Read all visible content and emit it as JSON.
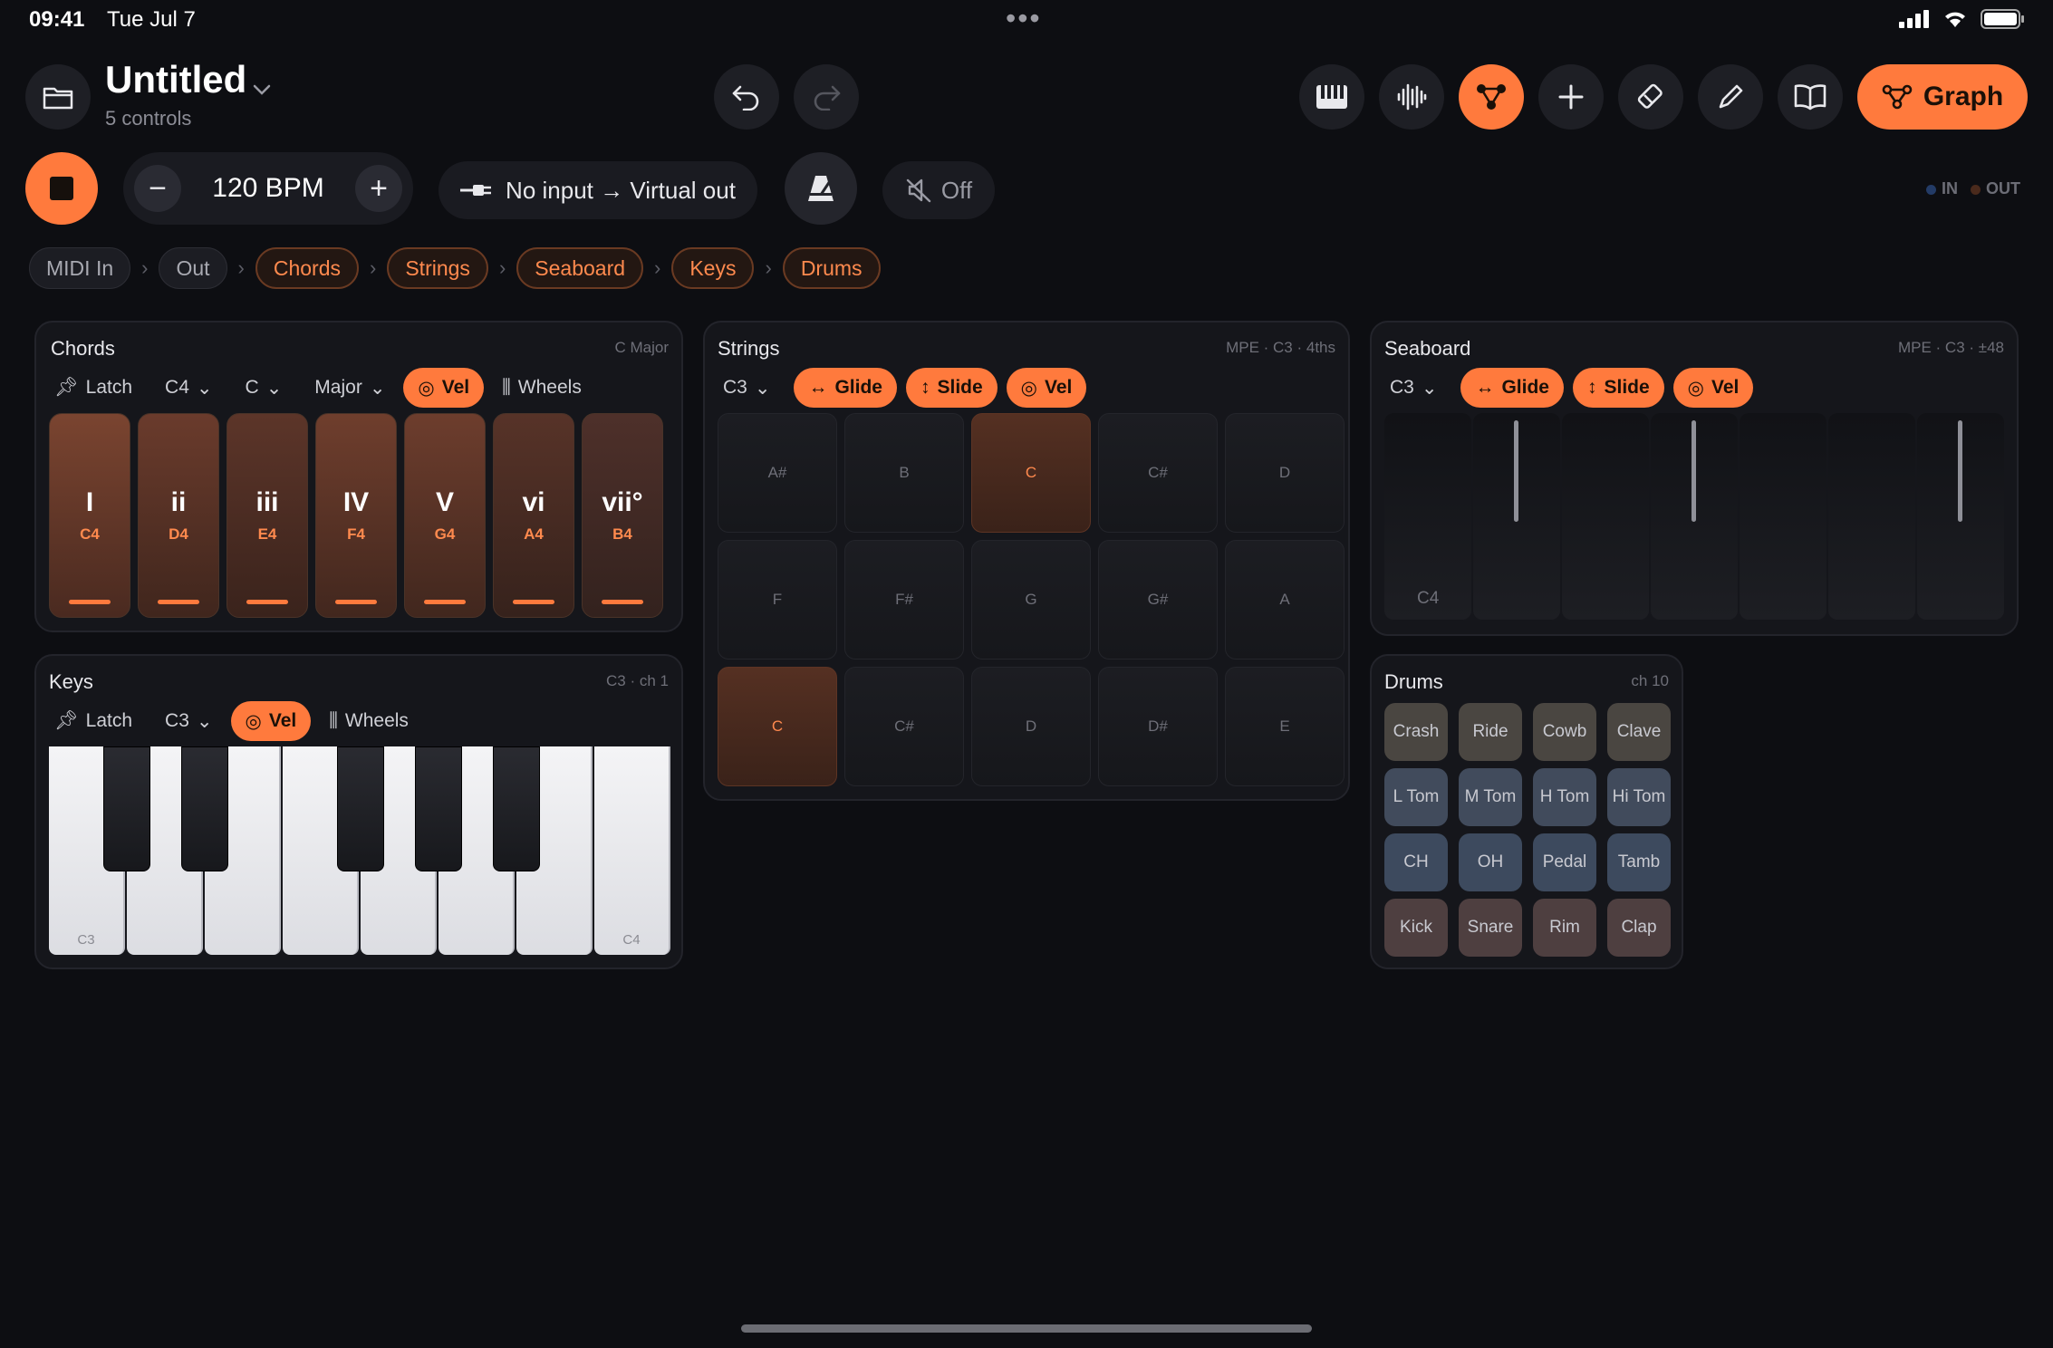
{
  "status": {
    "time": "09:41",
    "date": "Tue Jul 7",
    "dots": "•••"
  },
  "header": {
    "title": "Untitled",
    "subtitle": "5 controls",
    "graph_label": "Graph"
  },
  "transport": {
    "bpm": "120 BPM",
    "minus": "−",
    "plus": "+",
    "io": "No input → Virtual out",
    "off": "Off",
    "in_label": "IN",
    "out_label": "OUT"
  },
  "colors": {
    "accent": "#ff7a3d",
    "background": "#0d0e12",
    "in_dot": "#2a4a7a",
    "out_dot": "#5a3020"
  },
  "breadcrumb": [
    "MIDI In",
    "Out",
    "Chords",
    "Strings",
    "Seaboard",
    "Keys",
    "Drums"
  ],
  "chords": {
    "title": "Chords",
    "meta": "C Major",
    "latch": "Latch",
    "root": "C4",
    "key": "C",
    "scale": "Major",
    "vel": "Vel",
    "wheels": "Wheels",
    "pads": [
      {
        "num": "I",
        "note": "C4"
      },
      {
        "num": "ii",
        "note": "D4"
      },
      {
        "num": "iii",
        "note": "E4"
      },
      {
        "num": "IV",
        "note": "F4"
      },
      {
        "num": "V",
        "note": "G4"
      },
      {
        "num": "vi",
        "note": "A4"
      },
      {
        "num": "vii°",
        "note": "B4"
      }
    ]
  },
  "strings": {
    "title": "Strings",
    "meta": "MPE · C3 · 4ths",
    "root": "C3",
    "glide": "Glide",
    "slide": "Slide",
    "vel": "Vel",
    "cells": [
      "A#",
      "B",
      "C",
      "C#",
      "D",
      "F",
      "F#",
      "G",
      "G#",
      "A",
      "C",
      "C#",
      "D",
      "D#",
      "E"
    ]
  },
  "seaboard": {
    "title": "Seaboard",
    "meta": "MPE · C3 · ±48",
    "root": "C3",
    "glide": "Glide",
    "slide": "Slide",
    "vel": "Vel",
    "first_key": "C4"
  },
  "keys": {
    "title": "Keys",
    "meta": "C3 · ch 1",
    "latch": "Latch",
    "root": "C3",
    "vel": "Vel",
    "wheels": "Wheels",
    "low_label": "C3",
    "high_label": "C4"
  },
  "drums": {
    "title": "Drums",
    "meta": "ch 10",
    "pads": [
      "Crash",
      "Ride",
      "Cowb",
      "Clave",
      "L Tom",
      "M Tom",
      "H Tom",
      "Hi Tom",
      "CH",
      "OH",
      "Pedal",
      "Tamb",
      "Kick",
      "Snare",
      "Rim",
      "Clap"
    ]
  }
}
